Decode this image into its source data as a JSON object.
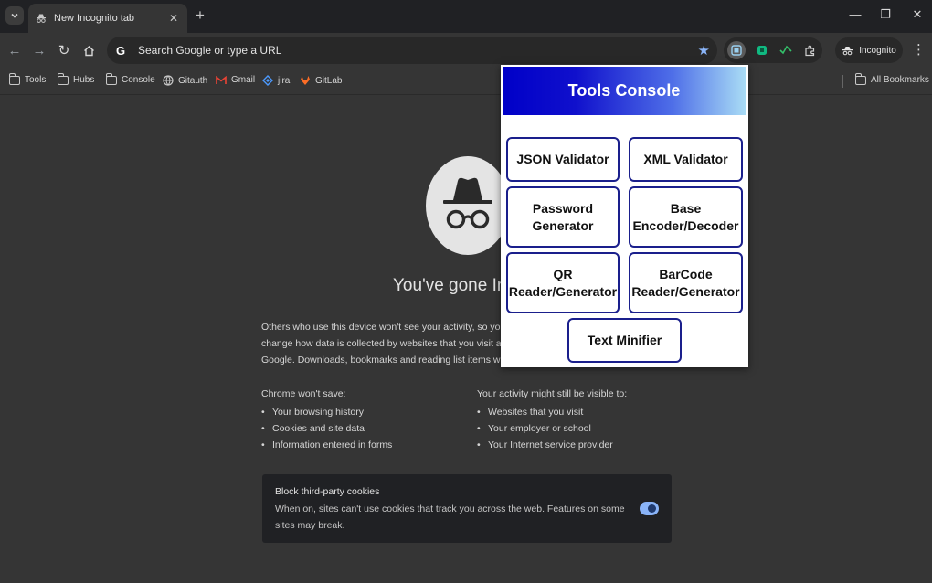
{
  "browser": {
    "tab_title": "New Incognito tab",
    "omnibox_placeholder": "Search Google or type a URL",
    "profile_label": "Incognito",
    "colors": {
      "accent": "#8ab4f8",
      "page_bg": "#353535",
      "frame_bg": "#202124"
    }
  },
  "bookmarks": {
    "items": [
      {
        "label": "Tools",
        "icon": "folder-icon"
      },
      {
        "label": "Hubs",
        "icon": "folder-icon"
      },
      {
        "label": "Console",
        "icon": "folder-icon"
      },
      {
        "label": "Gitauth",
        "icon": "globe-icon"
      },
      {
        "label": "Gmail",
        "icon": "gmail-icon"
      },
      {
        "label": "jira",
        "icon": "jira-icon"
      },
      {
        "label": "GitLab",
        "icon": "gitlab-icon"
      }
    ],
    "all_label": "All Bookmarks"
  },
  "incognito": {
    "title": "You've gone Inco",
    "intro_lines": [
      "Others who use this device won't see your activity, so you",
      "change how data is collected by websites that you visit a",
      "Google. Downloads, bookmarks and reading list items wi"
    ],
    "wont_save_heading": "Chrome won't save:",
    "wont_save": [
      "Your browsing history",
      "Cookies and site data",
      "Information entered in forms"
    ],
    "visible_heading": "Your activity might still be visible to:",
    "visible": [
      "Websites that you visit",
      "Your employer or school",
      "Your Internet service provider"
    ],
    "cookies_title": "Block third-party cookies",
    "cookies_desc": "When on, sites can't use cookies that track you across the web. Features on some sites may break.",
    "cookies_toggle_on": true
  },
  "popup": {
    "title": "Tools Console",
    "header_colors": [
      "#0000c8",
      "#a9dcf5"
    ],
    "border_color": "#1a1f8c",
    "buttons": [
      {
        "label": "JSON Validator"
      },
      {
        "label": "XML Validator"
      },
      {
        "label": "Password Generator"
      },
      {
        "label": "Base Encoder/Decoder"
      },
      {
        "label": "QR Reader/Generator"
      },
      {
        "label": "BarCode Reader/Generator"
      },
      {
        "label": "Text Minifier"
      }
    ]
  }
}
